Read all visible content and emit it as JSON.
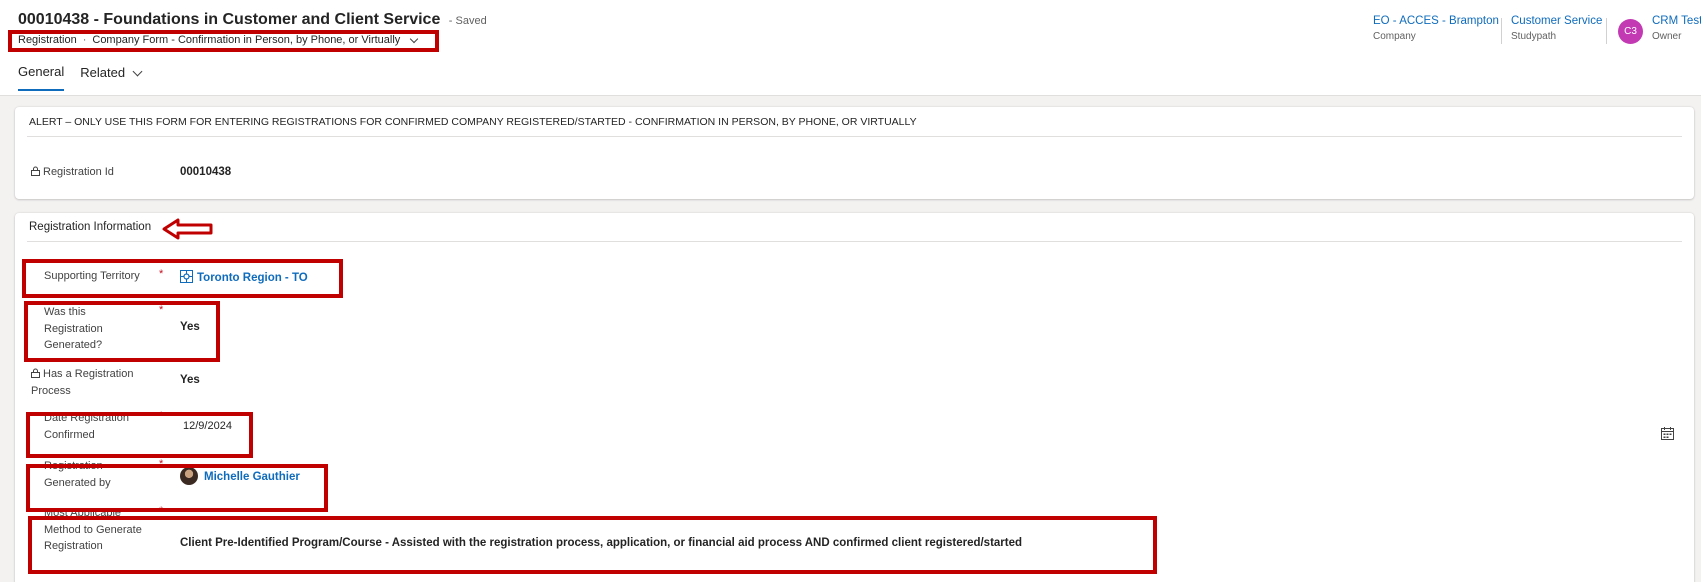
{
  "record": {
    "title": "00010438 - Foundations in Customer and Client Service",
    "save_status": "- Saved",
    "entity": "Registration",
    "form_separator": "·",
    "form_name": "Company Form - Confirmation in Person, by Phone, or Virtually"
  },
  "tabs": [
    {
      "label": "General"
    },
    {
      "label": "Related"
    }
  ],
  "header_fields": [
    {
      "value": "EO - ACCES - Brampton",
      "label": "Company"
    },
    {
      "value": "Customer Service",
      "label": "Studypath"
    },
    {
      "value": "CRM Test",
      "label": "Owner",
      "initials": "C3"
    }
  ],
  "alert": {
    "text": "ALERT – ONLY USE THIS FORM FOR ENTERING REGISTRATIONS FOR CONFIRMED COMPANY REGISTERED/STARTED - CONFIRMATION IN PERSON, BY PHONE, OR VIRTUALLY",
    "registration_id_label": "Registration Id",
    "registration_id_value": "00010438"
  },
  "section": {
    "title": "Registration Information",
    "fields": {
      "territory": {
        "label": "Supporting Territory",
        "value": "Toronto Region - TO",
        "required": "*"
      },
      "generated": {
        "label": "Was this Registration Generated?",
        "value": "Yes",
        "required": "*"
      },
      "process": {
        "label": "Has a Registration Process",
        "value": "Yes"
      },
      "date": {
        "label": "Date Registration Confirmed",
        "value": "12/9/2024",
        "required": "*"
      },
      "generated_by": {
        "label": "Registration Generated by",
        "value": "Michelle Gauthier",
        "required": "*"
      },
      "method": {
        "label": "Most Applicable Method to Generate Registration",
        "value": "Client Pre-Identified Program/Course - Assisted with the registration process, application, or financial aid process AND confirmed client registered/started",
        "required": "*"
      }
    }
  },
  "colors": {
    "accent": "#0f6cbd",
    "annotation": "#c00000",
    "required": "#c50f1f",
    "owner_avatar": "#c239b3"
  },
  "icons": [
    "chevron-down-icon",
    "lock-icon",
    "territory-icon",
    "user-avatar",
    "calendar-icon",
    "arrow-annotation"
  ]
}
